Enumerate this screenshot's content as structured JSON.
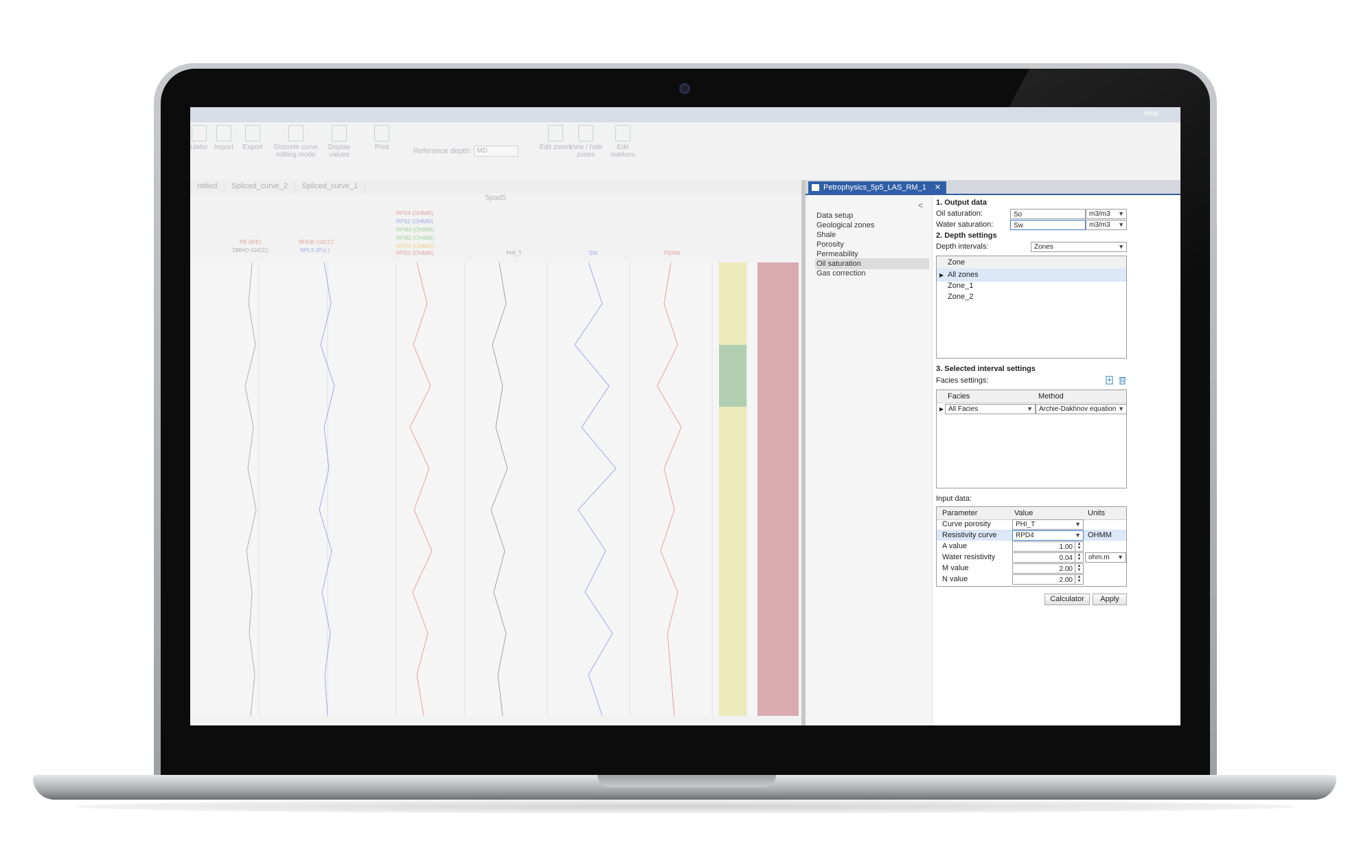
{
  "ribbon": {
    "buttons": [
      "ulator",
      "Import",
      "Export",
      "Discrete curve editing mode",
      "Display values",
      "Print",
      "Edit zones",
      "View / hide zones",
      "Edit markers"
    ],
    "reference_depth_label": "Reference depth:",
    "reference_depth_value": "MD",
    "help_label": "Help"
  },
  "doc_tabs": [
    "ntitled",
    "Spliced_curve_2",
    "Spliced_curve_1"
  ],
  "well_name": "5pad5",
  "curve_headers": [
    "PE (B/E)",
    "DRHO (G/CC)",
    "RHOB (G/CC)",
    "NPLS (P.U.)",
    "RPS4 (OHMM)",
    "RPS2 (OHMM)",
    "RPM4 (OHMM)",
    "RPM2 (OHMM)",
    "RPD4 (OHMM)",
    "RPD2 (OHMM)",
    "PHI_T",
    "SW",
    "PERM"
  ],
  "panel": {
    "tab_title": "Petrophysics_5p5_LAS_RM_1",
    "collapse_glyph": "<",
    "nav": [
      "Data setup",
      "Geological zones",
      "Shale",
      "Porosity",
      "Permeability",
      "Oil saturation",
      "Gas correction"
    ],
    "output": {
      "title": "1. Output data",
      "oil_label": "Oil saturation:",
      "oil_value": "So",
      "oil_unit": "m3/m3",
      "water_label": "Water saturation:",
      "water_value": "Sw",
      "water_unit": "m3/m3"
    },
    "depth": {
      "title": "2. Depth settings",
      "intervals_label": "Depth intervals:",
      "intervals_value": "Zones",
      "zone_header": "Zone",
      "zones": [
        "All zones",
        "Zone_1",
        "Zone_2"
      ]
    },
    "interval": {
      "title": "3. Selected interval settings",
      "facies_label": "Facies settings:",
      "facies_header": "Facies",
      "method_header": "Method",
      "facies_value": "All Facies",
      "method_value": "Archie-Dakhnov equation"
    },
    "input": {
      "title": "Input data:",
      "headers": [
        "Parameter",
        "Value",
        "Units"
      ],
      "rows": [
        {
          "param": "Curve porosity",
          "value": "PHI_T",
          "unit": ""
        },
        {
          "param": "Resistivity curve",
          "value": "RPD4",
          "unit": "OHMM"
        },
        {
          "param": "A value",
          "value": "1.00",
          "unit": ""
        },
        {
          "param": "Water resistivity",
          "value": "0.04",
          "unit": "ohm.m"
        },
        {
          "param": "M value",
          "value": "2.00",
          "unit": ""
        },
        {
          "param": "N value",
          "value": "2.00",
          "unit": ""
        }
      ]
    },
    "buttons": {
      "calculator": "Calculator",
      "apply": "Apply"
    }
  }
}
